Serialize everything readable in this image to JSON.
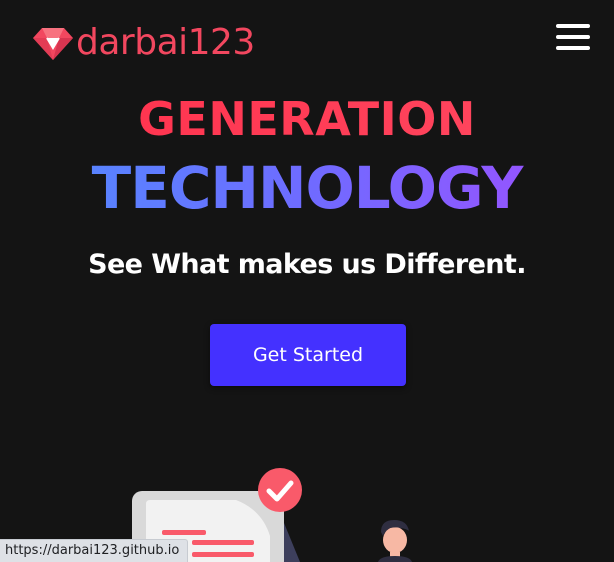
{
  "brand": {
    "name": "darbai123",
    "logo_icon": "diamond-icon",
    "color": "#f2475f"
  },
  "header": {
    "menu_icon": "hamburger-menu-icon"
  },
  "hero": {
    "headline_top": "GENERATION",
    "headline_bottom": "TECHNOLOGY",
    "tagline": "See What makes us Different.",
    "cta_label": "Get Started",
    "cta_color": "#4431ff",
    "headline_top_color": "#ff3c58",
    "headline_bottom_gradient": [
      "#4f8dff",
      "#a24dff"
    ]
  },
  "illustration": {
    "icons": [
      "checkmark-badge-icon",
      "document-illustration",
      "person-illustration"
    ]
  },
  "status_bar": {
    "url": "https://darbai123.github.io"
  },
  "colors": {
    "background": "#141414",
    "text": "#ffffff",
    "accent_red": "#f95a6a"
  }
}
